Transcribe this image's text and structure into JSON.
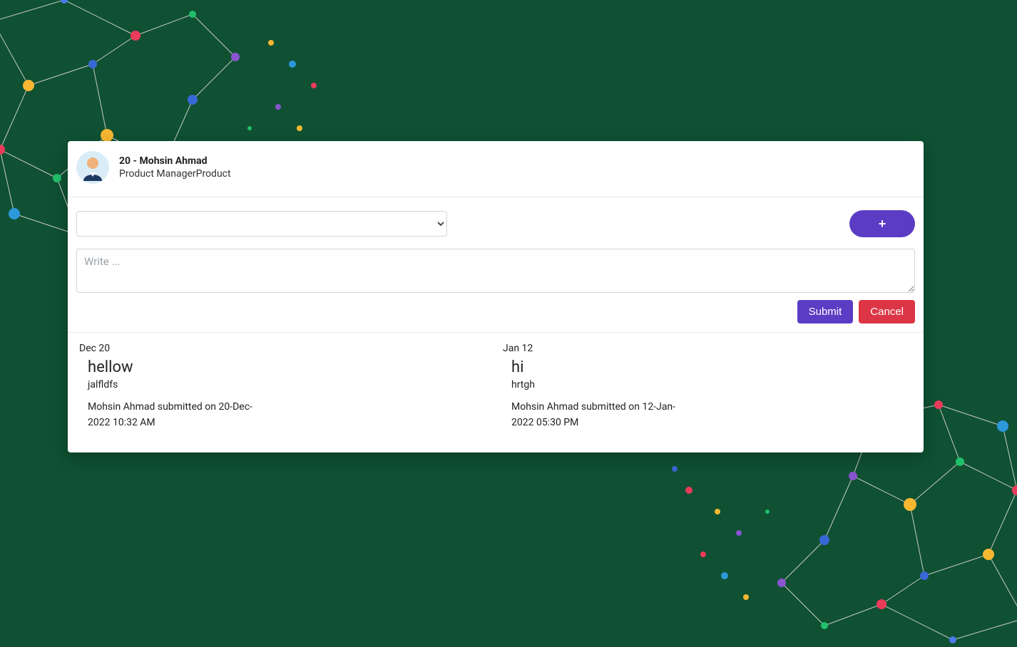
{
  "header": {
    "title": "20 - Mohsin Ahmad",
    "subtitle": "Product ManagerProduct"
  },
  "form": {
    "select_value": "",
    "add_label": "+",
    "textarea_placeholder": "Write ...",
    "submit_label": "Submit",
    "cancel_label": "Cancel"
  },
  "notes": [
    {
      "date": "Dec 20",
      "title": "hellow",
      "body": "jalfldfs",
      "meta": "Mohsin Ahmad submitted on 20-Dec-2022 10:32 AM"
    },
    {
      "date": "Jan 12",
      "title": "hi",
      "body": "hrtgh",
      "meta": "Mohsin Ahmad submitted on 12-Jan-2022 05:30 PM"
    }
  ],
  "colors": {
    "primary": "#5b3cc4",
    "danger": "#dc3545",
    "background": "#0f5132"
  }
}
